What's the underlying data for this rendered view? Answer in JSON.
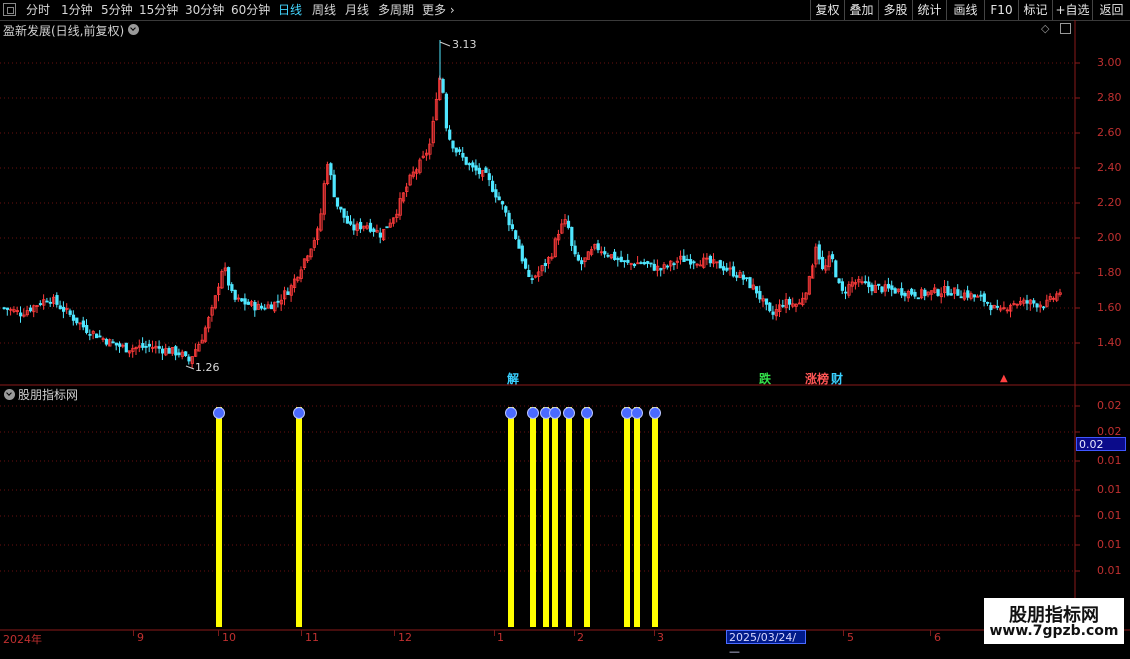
{
  "toolbar": {
    "tabs": [
      {
        "label": "分时",
        "active": false
      },
      {
        "label": "1分钟",
        "active": false
      },
      {
        "label": "5分钟",
        "active": false
      },
      {
        "label": "15分钟",
        "active": false
      },
      {
        "label": "30分钟",
        "active": false
      },
      {
        "label": "60分钟",
        "active": false
      },
      {
        "label": "日线",
        "active": true
      },
      {
        "label": "周线",
        "active": false
      },
      {
        "label": "月线",
        "active": false
      },
      {
        "label": "多周期",
        "active": false
      },
      {
        "label": "更多",
        "active": false
      }
    ],
    "right_buttons": [
      "复权",
      "叠加",
      "多股",
      "统计",
      "画线",
      "F10",
      "标记",
      "+自选",
      "返回"
    ]
  },
  "main_panel": {
    "title": "盈新发展(日线,前复权)",
    "price_axis": [
      "3.00",
      "2.80",
      "2.60",
      "2.40",
      "2.20",
      "2.00",
      "1.80",
      "1.60",
      "1.40"
    ],
    "high_label": "3.13",
    "low_label": "1.26",
    "events": [
      {
        "text": "解",
        "color": "#39d0ff"
      },
      {
        "text": "跌",
        "color": "#33e04a"
      },
      {
        "text": "涨榜",
        "color": "#ff5555"
      },
      {
        "text": "财",
        "color": "#39d0ff"
      }
    ]
  },
  "sub_panel": {
    "title": "股朋指标网",
    "axis": [
      "0.02",
      "0.02",
      "0.01",
      "0.01",
      "0.01",
      "0.01",
      "0.01"
    ],
    "current_value": "0.02"
  },
  "time_axis": {
    "labels": [
      "2024年",
      "9",
      "10",
      "11",
      "12",
      "1",
      "2",
      "3",
      "5",
      "6"
    ],
    "highlight_date": "2025/03/24/—"
  },
  "watermark": {
    "line1": "股朋指标网",
    "line2": "www.7gpzb.com"
  },
  "colors": {
    "up": "#ff3b3b",
    "down": "#4fe7ff",
    "signal": "#ffff00",
    "grid": "#6a0f0f"
  }
}
